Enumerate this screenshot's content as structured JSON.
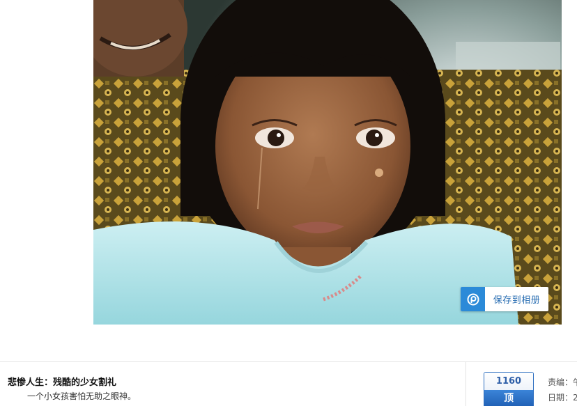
{
  "photo": {
    "save_button_label": "保存到相册",
    "save_icon": "album-save-icon"
  },
  "caption": {
    "title": "悲惨人生：残酷的少女割礼",
    "description": "一个小女孩害怕无助之眼神。"
  },
  "vote": {
    "count": "1160",
    "label": "顶"
  },
  "meta": {
    "editor_label": "责编：午",
    "date_label": "日期：2"
  },
  "colors": {
    "accent": "#2b8ad8",
    "vote_border": "#2e6fc0",
    "vote_bg": "#1f5fb4"
  }
}
